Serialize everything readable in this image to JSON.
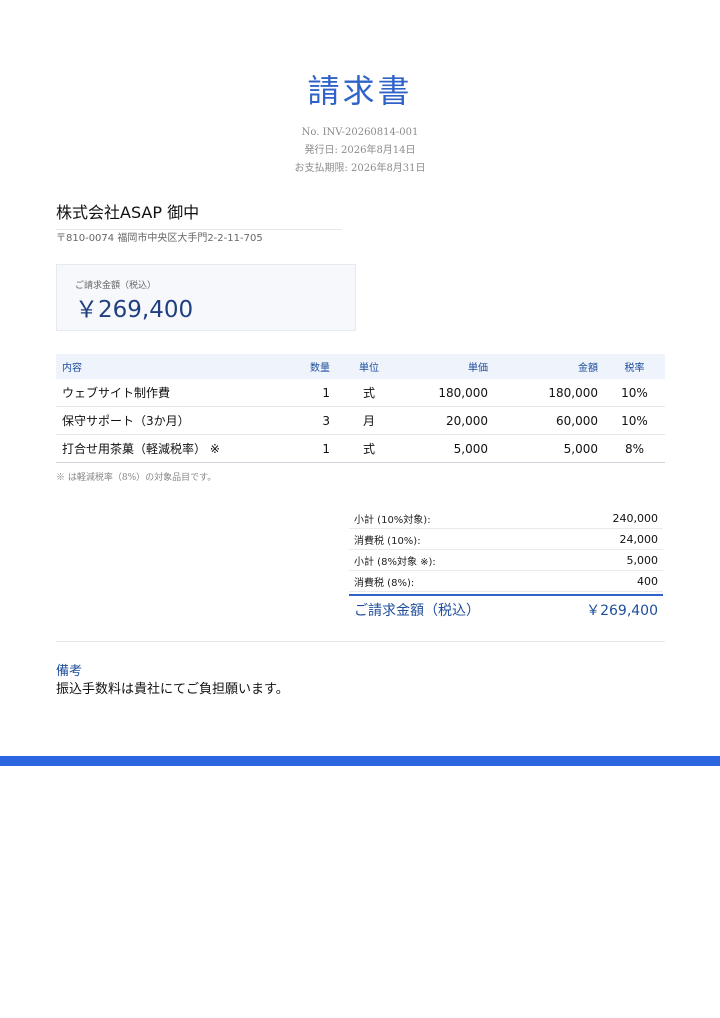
{
  "header": {
    "title": "請求書",
    "invoice_no": "No. INV-20260814-001",
    "issue_date": "発行日: 2026年8月14日",
    "due_date": "お支払期限: 2026年8月31日"
  },
  "recipient": {
    "name": "株式会社ASAP 御中",
    "address": "〒810-0074 福岡市中央区大手門2-2-11-705"
  },
  "amount_box": {
    "label": "ご請求金額（税込）",
    "value": "￥269,400"
  },
  "items": {
    "headers": [
      "内容",
      "数量",
      "単位",
      "単価",
      "金額",
      "税率"
    ],
    "rows": [
      [
        "ウェブサイト制作費",
        "1",
        "式",
        "180,000",
        "180,000",
        "10%"
      ],
      [
        "保守サポート（3か月）",
        "3",
        "月",
        "20,000",
        "60,000",
        "10%"
      ],
      [
        "打合せ用茶菓（軽減税率） ※",
        "1",
        "式",
        "5,000",
        "5,000",
        "8%"
      ]
    ],
    "footnote": "※ は軽減税率（8%）の対象品目です。"
  },
  "totals": {
    "rows": [
      [
        "小計 (10%対象):",
        "240,000"
      ],
      [
        "消費税 (10%):",
        "24,000"
      ],
      [
        "小計 (8%対象 ※):",
        "5,000"
      ],
      [
        "消費税 (8%):",
        "400"
      ]
    ],
    "grand_label": "ご請求金額（税込）",
    "grand_value": "￥269,400"
  },
  "notes": {
    "title": "備考",
    "body": "振込手数料は貴社にてご負担願います。"
  },
  "colors": {
    "accent": "#2b65e0",
    "heading": "#2f63c9",
    "header_bg": "#eef3fc"
  }
}
